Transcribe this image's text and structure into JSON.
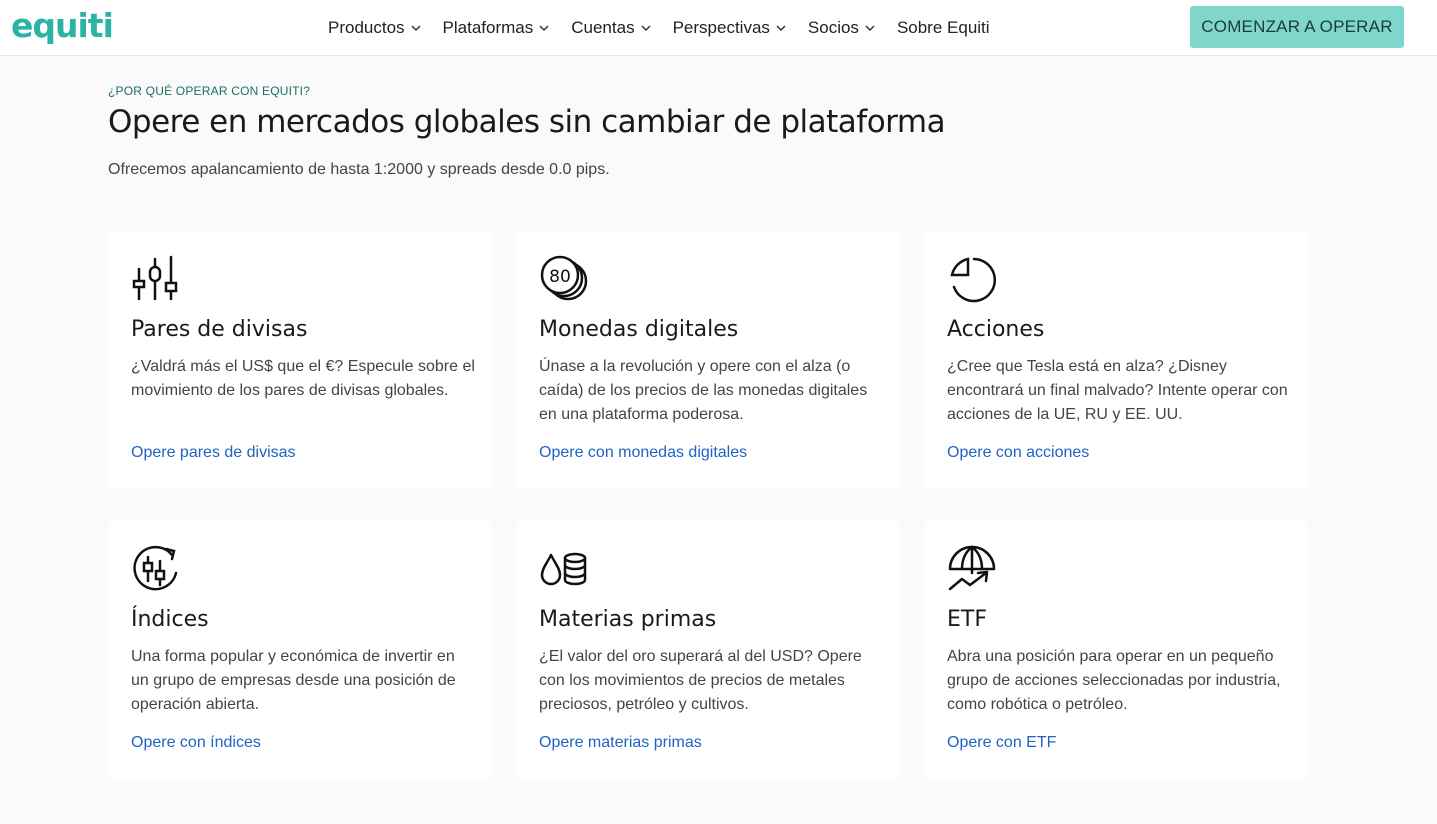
{
  "header": {
    "logo": "equiti",
    "nav": [
      "Productos",
      "Plataformas",
      "Cuentas",
      "Perspectivas",
      "Socios",
      "Sobre Equiti"
    ],
    "cta": "COMENZAR A OPERAR"
  },
  "section": {
    "eyebrow": "¿POR QUÉ OPERAR CON EQUITI?",
    "title": "Opere en mercados globales sin cambiar de plataforma",
    "subtitle": "Ofrecemos apalancamiento de hasta 1:2000 y spreads desde 0.0 pips."
  },
  "cards": [
    {
      "icon": "candlestick-icon",
      "title": "Pares de divisas",
      "description": "¿Valdrá más el US$ que el €? Especule sobre el movimiento de los pares de divisas globales.",
      "link": "Opere pares de divisas"
    },
    {
      "icon": "coins-icon",
      "icon_text": "80",
      "title": "Monedas digitales",
      "description": "Únase a la revolución y opere con el alza (o caída) de los precios de las monedas digitales en una plataforma poderosa.",
      "link": "Opere con monedas digitales"
    },
    {
      "icon": "pie-chart-icon",
      "title": "Acciones",
      "description": "¿Cree que Tesla está en alza? ¿Disney encontrará un final malvado? Intente operar con acciones de la UE, RU y EE. UU.",
      "link": "Opere con acciones"
    },
    {
      "icon": "index-cycle-icon",
      "title": "Índices",
      "description": "Una forma popular y económica de invertir en un grupo de empresas desde una posición de operación abierta.",
      "link": "Opere con índices"
    },
    {
      "icon": "drop-barrel-icon",
      "title": "Materias primas",
      "description": "¿El valor del oro superará al del USD? Opere con los movimientos de precios de metales preciosos, petróleo y cultivos.",
      "link": "Opere materias primas"
    },
    {
      "icon": "umbrella-chart-icon",
      "title": "ETF",
      "description": "Abra una posición para operar en un pequeño grupo de acciones seleccionadas por industria, como robótica o petróleo.",
      "link": "Opere con ETF"
    }
  ],
  "colors": {
    "brand": "#2bb3a6",
    "cta": "#7fd7cb",
    "link": "#1e63c6"
  }
}
